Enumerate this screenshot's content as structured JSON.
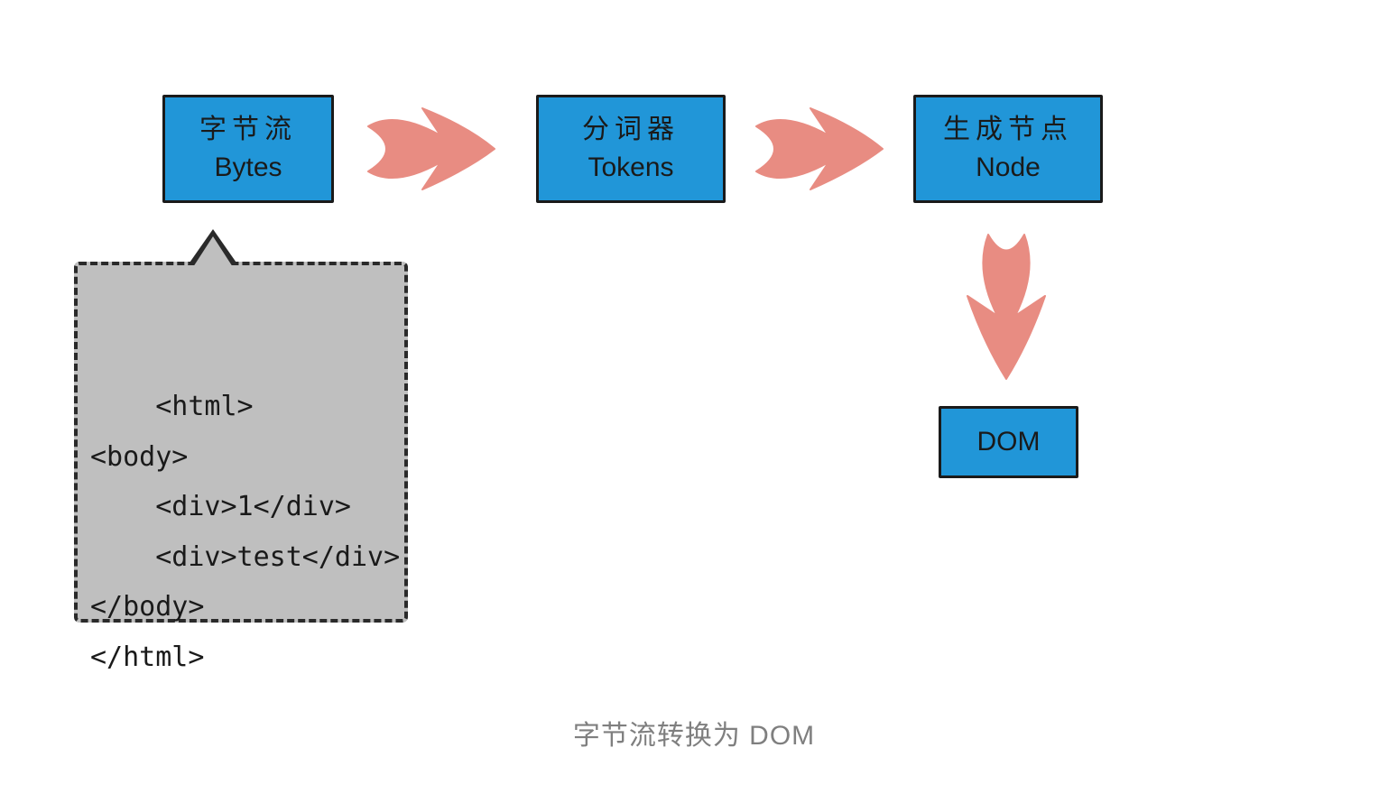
{
  "colors": {
    "box_fill": "#2196d8",
    "arrow": "#e88c82",
    "callout_fill": "#bfbfbf",
    "stroke": "#1a1a1a",
    "caption": "#7f7f7f"
  },
  "boxes": {
    "bytes": {
      "cn": "字节流",
      "en": "Bytes"
    },
    "tokens": {
      "cn": "分词器",
      "en": "Tokens"
    },
    "node": {
      "cn": "生成节点",
      "en": "Node"
    },
    "dom": {
      "label": "DOM"
    }
  },
  "callout_code": "<html>\n<body>\n    <div>1</div>\n    <div>test</div>\n</body>\n</html>",
  "caption": "字节流转换为 DOM"
}
